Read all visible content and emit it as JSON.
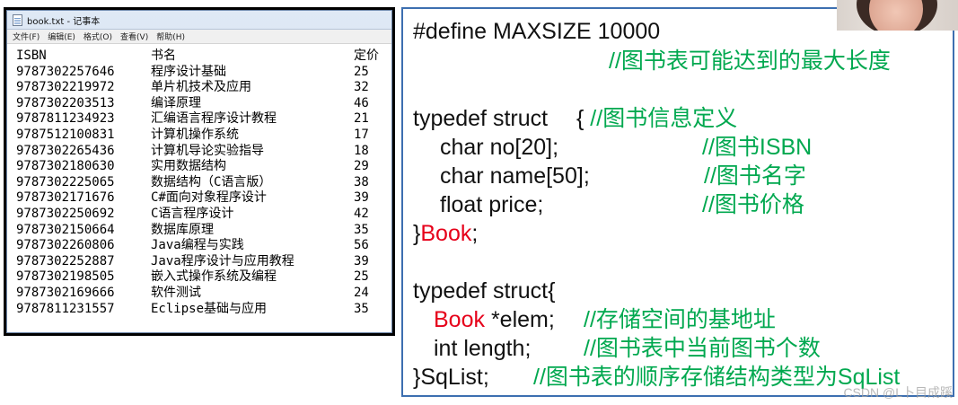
{
  "notepad": {
    "title": "book.txt - 记事本",
    "menu": [
      "文件(F)",
      "编辑(E)",
      "格式(O)",
      "查看(V)",
      "帮助(H)"
    ],
    "header": [
      "ISBN",
      "书名",
      "定价"
    ],
    "rows": [
      [
        "9787302257646",
        "程序设计基础",
        "25"
      ],
      [
        "9787302219972",
        "单片机技术及应用",
        "32"
      ],
      [
        "9787302203513",
        "编译原理",
        "46"
      ],
      [
        "9787811234923",
        "汇编语言程序设计教程",
        "21"
      ],
      [
        "9787512100831",
        "计算机操作系统",
        "17"
      ],
      [
        "9787302265436",
        "计算机导论实验指导",
        "18"
      ],
      [
        "9787302180630",
        "实用数据结构",
        "29"
      ],
      [
        "9787302225065",
        "数据结构（C语言版）",
        "38"
      ],
      [
        "9787302171676",
        "C#面向对象程序设计",
        "39"
      ],
      [
        "9787302250692",
        "C语言程序设计",
        "42"
      ],
      [
        "9787302150664",
        "数据库原理",
        "35"
      ],
      [
        "9787302260806",
        "Java编程与实践",
        "56"
      ],
      [
        "9787302252887",
        "Java程序设计与应用教程",
        "39"
      ],
      [
        "9787302198505",
        "嵌入式操作系统及编程",
        "25"
      ],
      [
        "9787302169666",
        "软件测试",
        "24"
      ],
      [
        "9787811231557",
        "Eclipse基础与应用",
        "35"
      ]
    ]
  },
  "code": {
    "define": "#define MAXSIZE 10000",
    "define_comment": "//图书表可能达到的最大长度",
    "struct1_open": "typedef struct",
    "struct1_brace": "{",
    "struct1_comment": "//图书信息定义",
    "f1": "char no[20];",
    "f1_comment": "//图书ISBN",
    "f2": "char name[50];",
    "f2_comment": "//图书名字",
    "f3": "float price;",
    "f3_comment": "//图书价格",
    "close1_brace": "}",
    "close1_name": "Book",
    "close1_semi": ";",
    "struct2_open": "typedef struct{",
    "g1_type": "Book",
    "g1_rest": "*elem;",
    "g1_comment": "//存储空间的基地址",
    "g2": "int length;",
    "g2_comment": "//图书表中当前图书个数",
    "close2": "}SqList;",
    "close2_comment": "//图书表的顺序存储结构类型为SqList"
  },
  "watermark": "CSDN @L卜目成蹊",
  "colors": {
    "comment": "#00a84f",
    "keyword_red": "#e6001a",
    "panel_border": "#3d6fb0"
  }
}
